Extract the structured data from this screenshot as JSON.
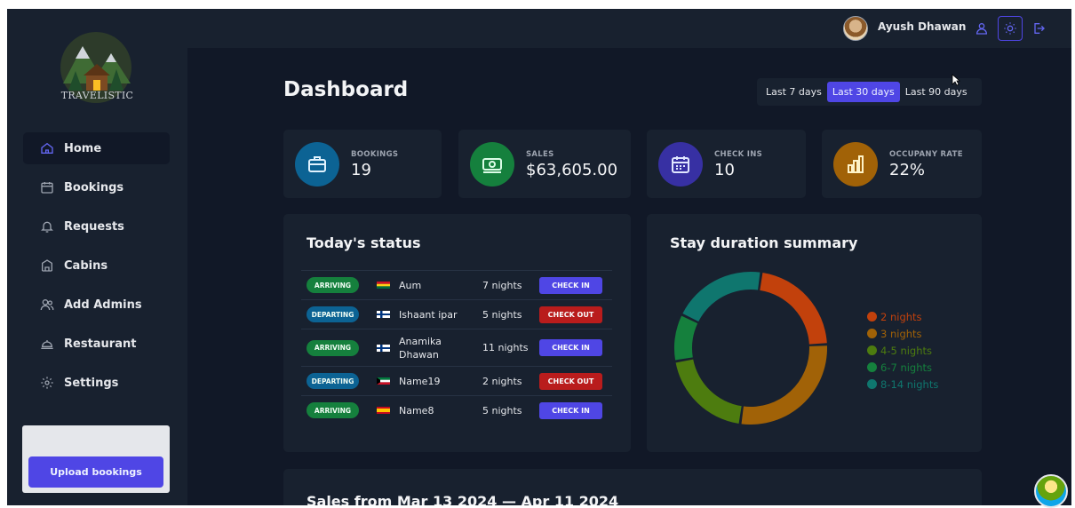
{
  "sidebar": {
    "logo_text": "TRAVELISTIC",
    "items": [
      {
        "label": "Home",
        "icon": "home-icon",
        "active": true
      },
      {
        "label": "Bookings",
        "icon": "calendar-icon"
      },
      {
        "label": "Requests",
        "icon": "bell-icon"
      },
      {
        "label": "Cabins",
        "icon": "cabin-icon"
      },
      {
        "label": "Add Admins",
        "icon": "users-icon"
      },
      {
        "label": "Restaurant",
        "icon": "restaurant-icon"
      },
      {
        "label": "Settings",
        "icon": "gear-icon"
      }
    ],
    "upload_label": "Upload bookings"
  },
  "header": {
    "user_name": "Ayush Dhawan",
    "icons": [
      "user-icon",
      "sun-icon",
      "logout-icon"
    ]
  },
  "main": {
    "title": "Dashboard",
    "filters": [
      {
        "label": "Last 7 days",
        "active": false
      },
      {
        "label": "Last 30 days",
        "active": true
      },
      {
        "label": "Last 90 days",
        "active": false
      }
    ],
    "stats": [
      {
        "label": "BOOKINGS",
        "value": "19",
        "color": "#0c6394",
        "icon": "briefcase-icon"
      },
      {
        "label": "SALES",
        "value": "$63,605.00",
        "color": "#15803d",
        "icon": "banknote-icon"
      },
      {
        "label": "CHECK INS",
        "value": "10",
        "color": "#3730a3",
        "icon": "calendar-icon"
      },
      {
        "label": "OCCUPANY RATE",
        "value": "22%",
        "color": "#a16207",
        "icon": "bar-chart-icon"
      }
    ],
    "today": {
      "title": "Today's status",
      "rows": [
        {
          "status": "ARRIVING",
          "flag": "ghana-flag",
          "name": "Aum",
          "nights": "7 nights",
          "action": "CHECK IN"
        },
        {
          "status": "DEPARTING",
          "flag": "finland-flag",
          "name": "Ishaant ipar",
          "nights": "5 nights",
          "action": "CHECK OUT"
        },
        {
          "status": "ARRIVING",
          "flag": "finland-flag",
          "name": "Anamika Dhawan",
          "nights": "11 nights",
          "action": "CHECK IN"
        },
        {
          "status": "DEPARTING",
          "flag": "kuwait-flag",
          "name": "Name19",
          "nights": "2 nights",
          "action": "CHECK OUT"
        },
        {
          "status": "ARRIVING",
          "flag": "spain-flag",
          "name": "Name8",
          "nights": "5 nights",
          "action": "CHECK IN"
        }
      ]
    },
    "duration": {
      "title": "Stay duration summary",
      "legend": [
        {
          "label": "2 nights",
          "color": "#c2410c"
        },
        {
          "label": "3 nights",
          "color": "#a16207"
        },
        {
          "label": "4-5 nights",
          "color": "#4d7c0f"
        },
        {
          "label": "6-7 nights",
          "color": "#15803d"
        },
        {
          "label": "8-14 nights",
          "color": "#0f766e"
        }
      ]
    },
    "sales_title": "Sales from Mar 13 2024 — Apr 11 2024"
  },
  "chart_data": {
    "type": "pie",
    "title": "Stay duration summary",
    "categories": [
      "2 nights",
      "3 nights",
      "4-5 nights",
      "6-7 nights",
      "8-14 nights"
    ],
    "values": [
      22,
      28,
      20,
      10,
      20
    ],
    "colors": [
      "#c2410c",
      "#a16207",
      "#4d7c0f",
      "#15803d",
      "#0f766e"
    ],
    "donut": true,
    "legend_position": "right"
  }
}
